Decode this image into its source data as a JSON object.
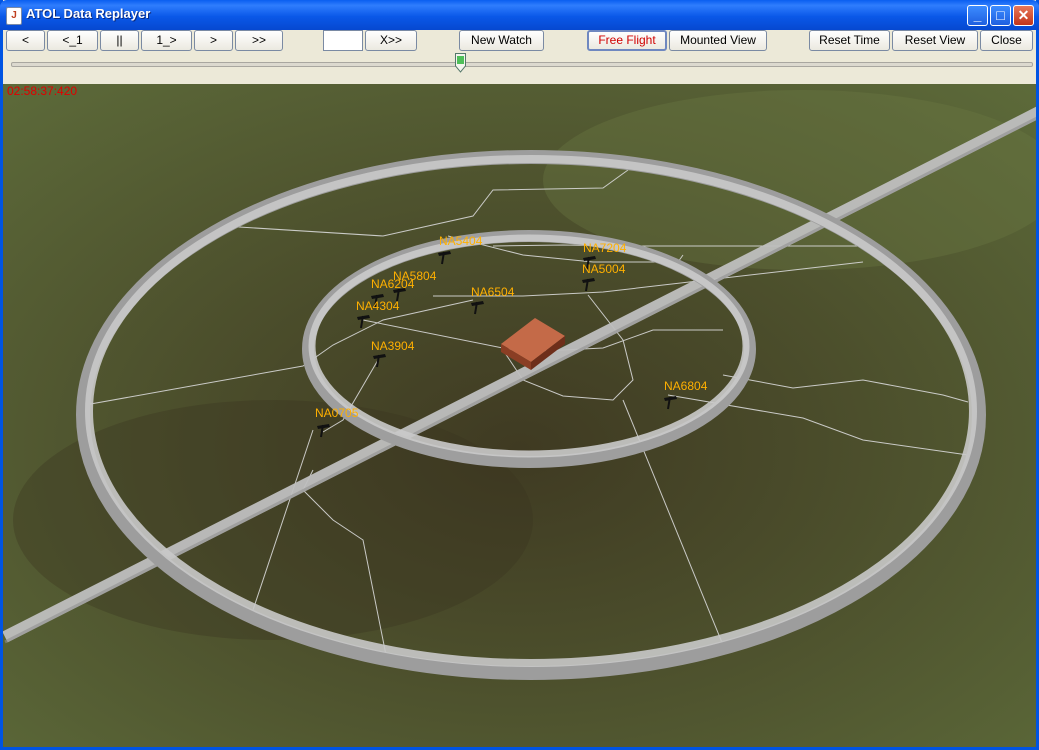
{
  "window": {
    "title": "ATOL Data Replayer",
    "app_icon_glyph": "J",
    "minimize_glyph": "_",
    "maximize_glyph": "□",
    "close_glyph": "✕"
  },
  "toolbar": {
    "btn_rewind_step": "<",
    "btn_rewind_1": "<_1",
    "btn_pause": "||",
    "btn_forward_1": "1_>",
    "btn_forward_step": ">",
    "btn_fast_forward": ">>",
    "jump_input_value": "",
    "btn_speed": "X>>",
    "btn_new_watch": "New Watch",
    "btn_free_flight": "Free Flight",
    "btn_mounted_view": "Mounted View",
    "btn_reset_time": "Reset Time",
    "btn_reset_view": "Reset View",
    "btn_close": "Close"
  },
  "timeline": {
    "position_fraction": 0.44
  },
  "scene": {
    "timestamp": "02:58:37:420",
    "aircraft_label_color": "#ffb000",
    "aircraft": [
      {
        "id": "NA5404"
      },
      {
        "id": "NA7204"
      },
      {
        "id": "NA5004"
      },
      {
        "id": "NA5804"
      },
      {
        "id": "NA6204"
      },
      {
        "id": "NA4304"
      },
      {
        "id": "NA6504"
      },
      {
        "id": "NA3904"
      },
      {
        "id": "NA6804"
      },
      {
        "id": "NA0705"
      }
    ]
  }
}
